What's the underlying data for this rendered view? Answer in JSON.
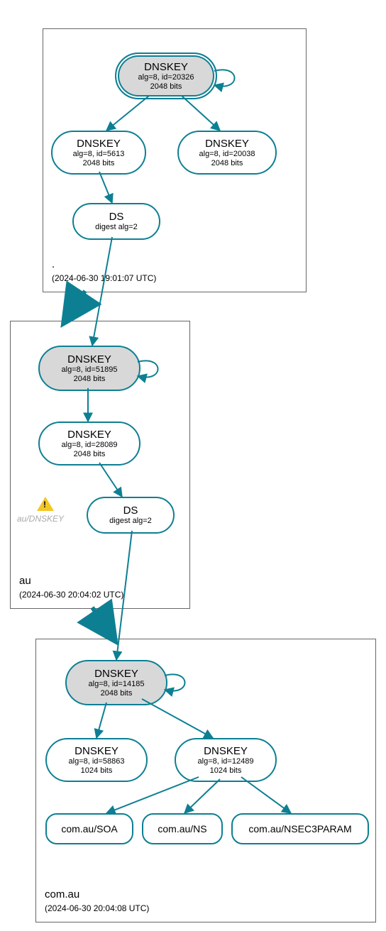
{
  "zones": {
    "root": {
      "label": ".",
      "timestamp": "(2024-06-30 19:01:07 UTC)"
    },
    "au": {
      "label": "au",
      "timestamp": "(2024-06-30 20:04:02 UTC)"
    },
    "comau": {
      "label": "com.au",
      "timestamp": "(2024-06-30 20:04:08 UTC)"
    }
  },
  "nodes": {
    "root_ksk": {
      "title": "DNSKEY",
      "line2": "alg=8, id=20326",
      "line3": "2048 bits"
    },
    "root_zsk1": {
      "title": "DNSKEY",
      "line2": "alg=8, id=5613",
      "line3": "2048 bits"
    },
    "root_zsk2": {
      "title": "DNSKEY",
      "line2": "alg=8, id=20038",
      "line3": "2048 bits"
    },
    "root_ds": {
      "title": "DS",
      "line2": "digest alg=2",
      "line3": ""
    },
    "au_ksk": {
      "title": "DNSKEY",
      "line2": "alg=8, id=51895",
      "line3": "2048 bits"
    },
    "au_zsk": {
      "title": "DNSKEY",
      "line2": "alg=8, id=28089",
      "line3": "2048 bits"
    },
    "au_ds": {
      "title": "DS",
      "line2": "digest alg=2",
      "line3": ""
    },
    "comau_ksk": {
      "title": "DNSKEY",
      "line2": "alg=8, id=14185",
      "line3": "2048 bits"
    },
    "comau_zsk1": {
      "title": "DNSKEY",
      "line2": "alg=8, id=58863",
      "line3": "1024 bits"
    },
    "comau_zsk2": {
      "title": "DNSKEY",
      "line2": "alg=8, id=12489",
      "line3": "1024 bits"
    }
  },
  "rrsets": {
    "soa": {
      "label": "com.au/SOA"
    },
    "ns": {
      "label": "com.au/NS"
    },
    "nsec3": {
      "label": "com.au/NSEC3PARAM"
    }
  },
  "warn": {
    "label": "au/DNSKEY"
  }
}
